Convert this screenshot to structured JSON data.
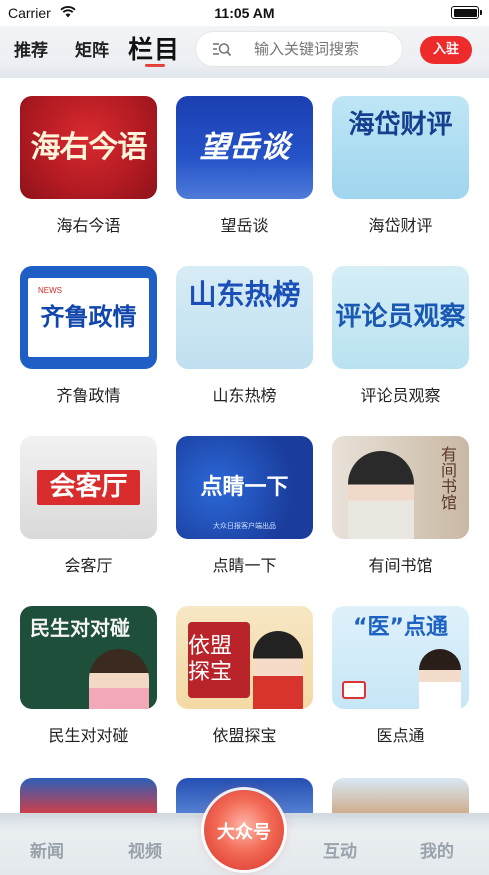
{
  "status_bar": {
    "carrier": "Carrier",
    "time": "11:05 AM",
    "wifi_icon": "wifi-icon",
    "battery_icon": "battery-icon"
  },
  "header": {
    "tabs": [
      {
        "label": "推荐"
      },
      {
        "label": "矩阵"
      },
      {
        "label": "栏目",
        "active": true
      }
    ],
    "search": {
      "placeholder": "输入关键词搜索",
      "icon": "search-icon"
    },
    "join_button": "入驻",
    "accent_color": "#e23b30"
  },
  "columns": [
    {
      "label": "海右今语",
      "thumb_text": "海右今语"
    },
    {
      "label": "望岳谈",
      "thumb_text": "望岳谈"
    },
    {
      "label": "海岱财评",
      "thumb_text": "海岱财评"
    },
    {
      "label": "齐鲁政情",
      "thumb_text": "齐鲁政情",
      "thumb_tag": "NEWS"
    },
    {
      "label": "山东热榜",
      "thumb_text": "山东热榜"
    },
    {
      "label": "评论员观察",
      "thumb_text": "评论员观察"
    },
    {
      "label": "会客厅",
      "thumb_text": "会客厅"
    },
    {
      "label": "点睛一下",
      "thumb_text": "点睛一下",
      "thumb_caption": "大众日报客户端出品"
    },
    {
      "label": "有间书馆",
      "thumb_text": "有间书馆"
    },
    {
      "label": "民生对对碰",
      "thumb_text": "民生对对碰"
    },
    {
      "label": "依盟探宝",
      "thumb_text": "依盟探宝"
    },
    {
      "label": "医点通",
      "thumb_text": "“医”点通"
    }
  ],
  "bottom_nav": {
    "items": [
      "新闻",
      "视频",
      "大众号",
      "互动",
      "我的"
    ],
    "center_color": "#d8322a"
  }
}
